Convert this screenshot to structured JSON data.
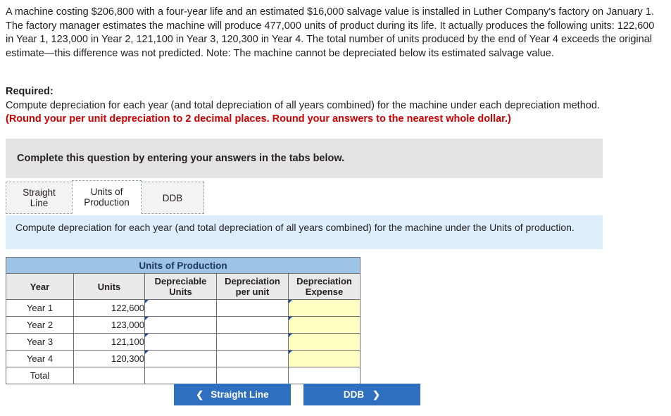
{
  "problem": {
    "text": "A machine costing $206,800 with a four-year life and an estimated $16,000 salvage value is installed in Luther Company's factory on January 1. The factory manager estimates the machine will produce 477,000 units of product during its life. It actually produces the following units: 122,600 in Year 1, 123,000 in Year 2, 121,100 in Year 3, 120,300 in Year 4. The total number of units produced by the end of Year 4 exceeds the original estimate—this difference was not predicted. Note: The machine cannot be depreciated below its estimated salvage value."
  },
  "required": {
    "title": "Required:",
    "line": "Compute depreciation for each year (and total depreciation of all years combined) for the machine under each depreciation method.",
    "note": "(Round your per unit depreciation to 2 decimal places. Round your answers to the nearest whole dollar.)"
  },
  "instruction_bar": {
    "text": "Complete this question by entering your answers in the tabs below."
  },
  "tabs": [
    {
      "label": "Straight Line",
      "active": false
    },
    {
      "label": "Units of Production",
      "active": true
    },
    {
      "label": "DDB",
      "active": false
    }
  ],
  "sub_instruction": {
    "text": "Compute depreciation for each year (and total depreciation of all years combined) for the machine under the Units of production."
  },
  "table": {
    "title": "Units of Production",
    "headers": [
      "Year",
      "Units",
      "Depreciable Units",
      "Depreciation per unit",
      "Depreciation Expense"
    ],
    "rows": [
      {
        "year": "Year 1",
        "units": "122,600",
        "depreciable_units": "",
        "per_unit": "",
        "expense": ""
      },
      {
        "year": "Year 2",
        "units": "123,000",
        "depreciable_units": "",
        "per_unit": "",
        "expense": ""
      },
      {
        "year": "Year 3",
        "units": "121,100",
        "depreciable_units": "",
        "per_unit": "",
        "expense": ""
      },
      {
        "year": "Year 4",
        "units": "120,300",
        "depreciable_units": "",
        "per_unit": "",
        "expense": ""
      },
      {
        "year": "Total",
        "units": "",
        "depreciable_units": "",
        "per_unit": "",
        "expense": ""
      }
    ]
  },
  "nav": {
    "prev_label": "Straight Line",
    "prev_icon": "chevron-left-icon",
    "next_label": "DDB",
    "next_icon": "chevron-right-icon"
  },
  "colors": {
    "accent": "#2f6fc0",
    "table_title_bg": "#9dc3e6",
    "input_highlight": "#ffffc2",
    "sub_instruction_bg": "#ddeefb",
    "instruction_bg": "#e3e3e3",
    "note_red": "#cc0000"
  }
}
